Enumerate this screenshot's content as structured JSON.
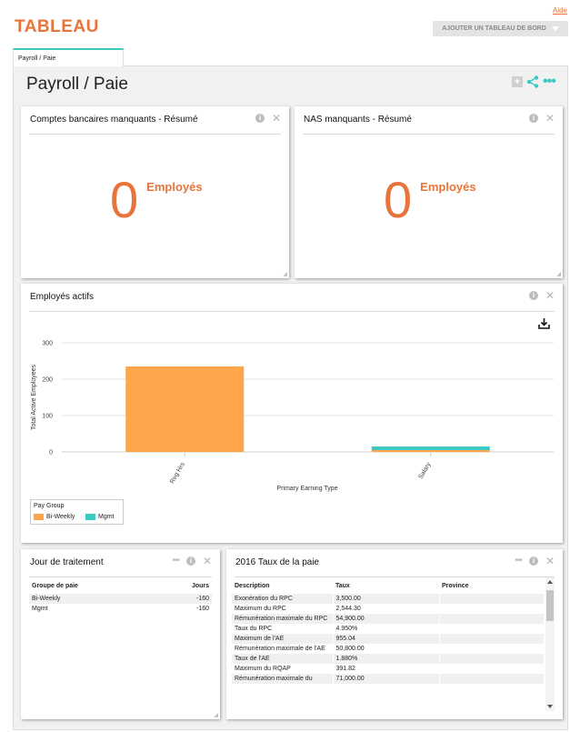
{
  "header": {
    "brand": "TABLEAU",
    "help_link": "Aide",
    "add_dashboard_button": "AJOUTER UN TABLEAU DE BORD"
  },
  "tabs": [
    {
      "label": "Payroll / Paie"
    }
  ],
  "page": {
    "title": "Payroll / Paie"
  },
  "colors": {
    "accent": "#e8743b",
    "teal": "#3cc9c1",
    "bar_orange": "#ffa64d"
  },
  "widgets": {
    "missing_bank": {
      "title": "Comptes bancaires manquants - Résumé",
      "value": "0",
      "unit": "Employés"
    },
    "missing_sin": {
      "title": "NAS manquants - Résumé",
      "value": "0",
      "unit": "Employés"
    },
    "active_employees": {
      "title": "Employés actifs",
      "legend_title": "Pay Group",
      "download_icon": "download-icon"
    },
    "processing_day": {
      "title": "Jour de traitement",
      "columns": [
        "Groupe de paie",
        "Jours"
      ],
      "rows": [
        {
          "group": "Bi-Weekly",
          "days": "-160"
        },
        {
          "group": "Mgmt",
          "days": "-160"
        }
      ]
    },
    "pay_rates": {
      "title": "2016 Taux de la paie",
      "columns": [
        "Description",
        "Taux",
        "Province"
      ],
      "rows": [
        {
          "description": "Exonération du RPC",
          "rate": "3,500.00",
          "province": ""
        },
        {
          "description": "Maximum du RPC",
          "rate": "2,544.30",
          "province": ""
        },
        {
          "description": "Rémunération maximale du RPC",
          "rate": "54,900.00",
          "province": ""
        },
        {
          "description": "Taux du RPC",
          "rate": "4.950%",
          "province": ""
        },
        {
          "description": "Maximum de l'AE",
          "rate": "955.04",
          "province": ""
        },
        {
          "description": "Rémunération maximale de l'AE",
          "rate": "50,800.00",
          "province": ""
        },
        {
          "description": "Taux de l'AE",
          "rate": "1.880%",
          "province": ""
        },
        {
          "description": "Maximum du RQAP",
          "rate": "391.82",
          "province": ""
        },
        {
          "description": "Rémunération maximale du",
          "rate": "71,000.00",
          "province": ""
        }
      ]
    }
  },
  "chart_data": {
    "type": "bar",
    "stacked": true,
    "categories": [
      "Reg Hrs",
      "Salary"
    ],
    "series": [
      {
        "name": "Bi-Weekly",
        "color": "#ffa64d",
        "values": [
          235,
          5
        ]
      },
      {
        "name": "Mgmt",
        "color": "#3cc9c1",
        "values": [
          0,
          10
        ]
      }
    ],
    "xlabel": "Primary Earning Type",
    "ylabel": "Total Active Employees",
    "ylim": [
      0,
      300
    ],
    "yticks": [
      "0",
      "100",
      "200",
      "300"
    ],
    "grid": true,
    "legend_position": "bottom-left"
  }
}
